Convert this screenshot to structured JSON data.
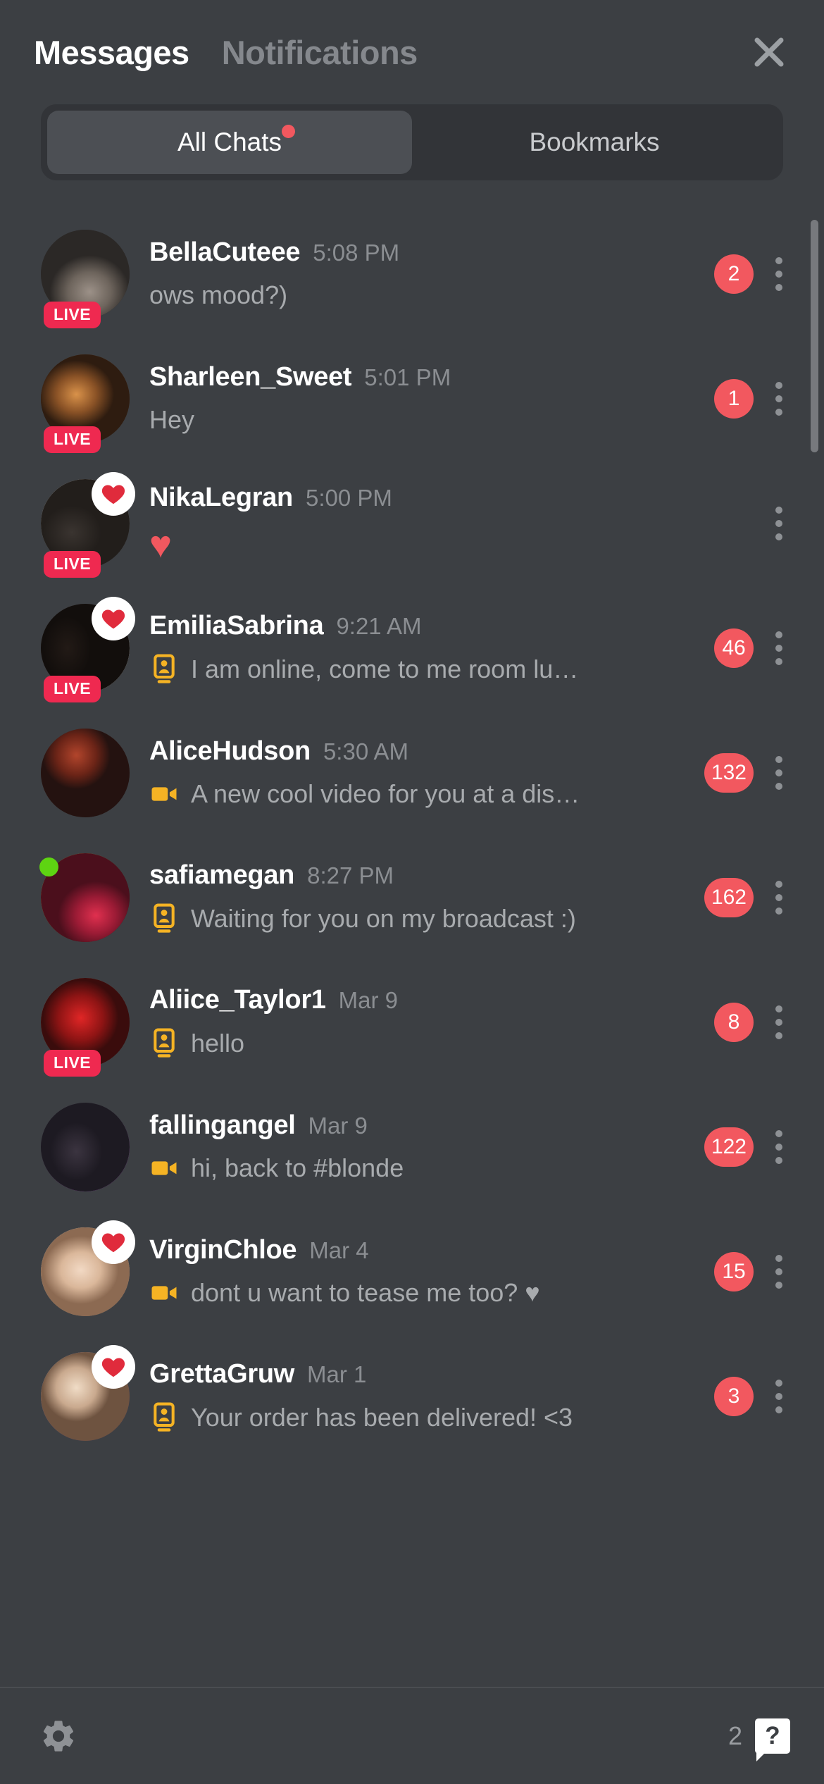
{
  "header": {
    "tabs": [
      {
        "label": "Messages",
        "active": true
      },
      {
        "label": "Notifications",
        "active": false
      }
    ],
    "close_icon": "close-icon"
  },
  "segment": {
    "items": [
      {
        "label": "All Chats",
        "active": true,
        "dot": true
      },
      {
        "label": "Bookmarks",
        "active": false,
        "dot": false
      }
    ]
  },
  "colors": {
    "background": "#3c3f43",
    "segment_track": "#323438",
    "segment_active": "#4c4f54",
    "accent_red": "#f2585f",
    "live_red": "#ef2950",
    "icon_yellow": "#f5b324",
    "online_green": "#5ed412",
    "text_primary": "#ffffff",
    "text_secondary": "#a8abae",
    "text_muted": "#8b8e92"
  },
  "chats": [
    {
      "username": "BellaCuteee",
      "time": "5:08 PM",
      "message": "ows mood?)",
      "message_icon": "none",
      "badge": "2",
      "live": true,
      "heart": false,
      "online": false,
      "avatar": "ph-bella",
      "emoji_only": false
    },
    {
      "username": "Sharleen_Sweet",
      "time": "5:01 PM",
      "message": "Hey",
      "message_icon": "none",
      "badge": "1",
      "live": true,
      "heart": false,
      "online": false,
      "avatar": "ph-sharleen",
      "emoji_only": false
    },
    {
      "username": "NikaLegran",
      "time": "5:00 PM",
      "message": "♥",
      "message_icon": "none",
      "badge": "",
      "live": true,
      "heart": true,
      "online": false,
      "avatar": "ph-nika",
      "emoji_only": true
    },
    {
      "username": "EmiliaSabrina",
      "time": "9:21 AM",
      "message": "I am online, come to me room lu…",
      "message_icon": "broadcast-card-icon",
      "badge": "46",
      "live": true,
      "heart": true,
      "online": false,
      "avatar": "ph-emilia",
      "emoji_only": false
    },
    {
      "username": "AliceHudson",
      "time": "5:30 AM",
      "message": "A new cool video for you at a dis…",
      "message_icon": "video-camera-icon",
      "badge": "132",
      "live": false,
      "heart": false,
      "online": false,
      "avatar": "ph-alice",
      "emoji_only": false
    },
    {
      "username": "safiamegan",
      "time": "8:27 PM",
      "message": "Waiting for you on my broadcast :)",
      "message_icon": "broadcast-card-icon",
      "badge": "162",
      "live": false,
      "heart": false,
      "online": true,
      "avatar": "ph-safia",
      "emoji_only": false
    },
    {
      "username": "Aliice_Taylor1",
      "time": "Mar 9",
      "message": "hello",
      "message_icon": "broadcast-card-icon",
      "badge": "8",
      "live": true,
      "heart": false,
      "online": false,
      "avatar": "ph-aliice",
      "emoji_only": false
    },
    {
      "username": "fallingangel",
      "time": "Mar 9",
      "message": "hi, back to #blonde",
      "message_icon": "video-camera-icon",
      "badge": "122",
      "live": false,
      "heart": false,
      "online": false,
      "avatar": "ph-falling",
      "emoji_only": false
    },
    {
      "username": "VirginChloe",
      "time": "Mar 4",
      "message": "dont u want to tease me too? ♥",
      "message_icon": "video-camera-icon",
      "badge": "15",
      "live": false,
      "heart": true,
      "online": false,
      "avatar": "ph-virgin",
      "emoji_only": false
    },
    {
      "username": "GrettaGruw",
      "time": "Mar 1",
      "message": "Your order has been delivered! <3",
      "message_icon": "broadcast-card-icon",
      "badge": "3",
      "live": false,
      "heart": true,
      "online": false,
      "avatar": "ph-gretta",
      "emoji_only": false
    }
  ],
  "footer": {
    "settings_icon": "gear-icon",
    "help_count": "2",
    "help_label": "?"
  }
}
